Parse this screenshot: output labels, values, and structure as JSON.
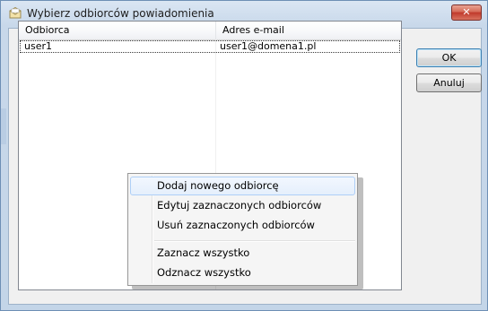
{
  "window": {
    "title": "Wybierz odbiorców powiadomienia",
    "close_label": "✕"
  },
  "listview": {
    "columns": [
      "Odbiorca",
      "Adres e-mail"
    ],
    "rows": [
      {
        "recipient": "user1",
        "email": "user1@domena1.pl"
      }
    ]
  },
  "buttons": {
    "ok": "OK",
    "cancel": "Anuluj"
  },
  "context_menu": {
    "items": [
      "Dodaj nowego odbiorcę",
      "Edytuj zaznaczonych odbiorców",
      "Usuń zaznaczonych odbiorców",
      "Zaznacz wszystko",
      "Odznacz wszystko"
    ],
    "highlighted_index": 0
  },
  "colors": {
    "title_bar": "#c8d8ea",
    "close_button": "#c0392b",
    "menu_highlight": "#e5effc"
  },
  "icons": {
    "title_icon": "envelope-icon"
  }
}
